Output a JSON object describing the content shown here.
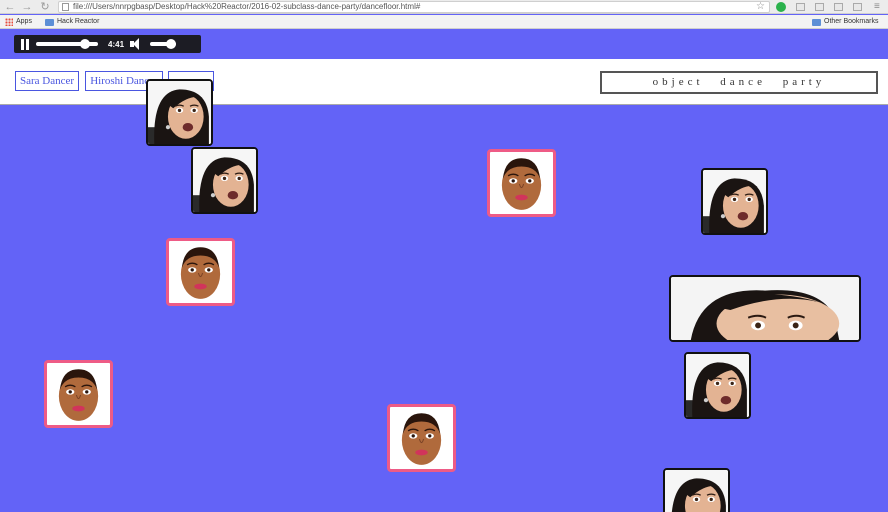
{
  "browser": {
    "url": "file:///Users/nnrpgbasp/Desktop/Hack%20Reactor/2016-02-subclass-dance-party/dancefloor.html#",
    "bookmarks": [
      {
        "label": "Apps",
        "icon": "apps-grid-icon"
      },
      {
        "label": "Hack Reactor",
        "icon": "folder-icon"
      }
    ],
    "other_bookmarks": "Other Bookmarks"
  },
  "audio_player": {
    "time": "4:41",
    "progress": 0.85,
    "volume": 0.8
  },
  "topbar": {
    "buttons": [
      {
        "label": "Sara Dancer"
      },
      {
        "label": "Hiroshi Dancer"
      },
      {
        "label": ""
      }
    ],
    "title": "object dance party"
  },
  "colors": {
    "floor": "#6363f7",
    "kim_border": "#111111",
    "oprah_border": "#ee5b86",
    "button_text": "#4a56e0"
  },
  "dancers": [
    {
      "kind": "kim-dancer",
      "icon": "kim-face-icon"
    },
    {
      "kind": "kim-dancer",
      "icon": "kim-face-icon"
    },
    {
      "kind": "oprah-dancer",
      "icon": "oprah-face-icon"
    },
    {
      "kind": "kim-dancer",
      "icon": "kim-face-icon"
    },
    {
      "kind": "oprah-dancer",
      "icon": "oprah-face-icon"
    },
    {
      "kind": "kim-wide-dancer",
      "icon": "kim-face-icon"
    },
    {
      "kind": "oprah-dancer",
      "icon": "oprah-face-icon"
    },
    {
      "kind": "kim-dancer",
      "icon": "kim-face-icon"
    },
    {
      "kind": "oprah-dancer",
      "icon": "oprah-face-icon"
    },
    {
      "kind": "kim-dancer",
      "icon": "kim-face-icon"
    }
  ]
}
